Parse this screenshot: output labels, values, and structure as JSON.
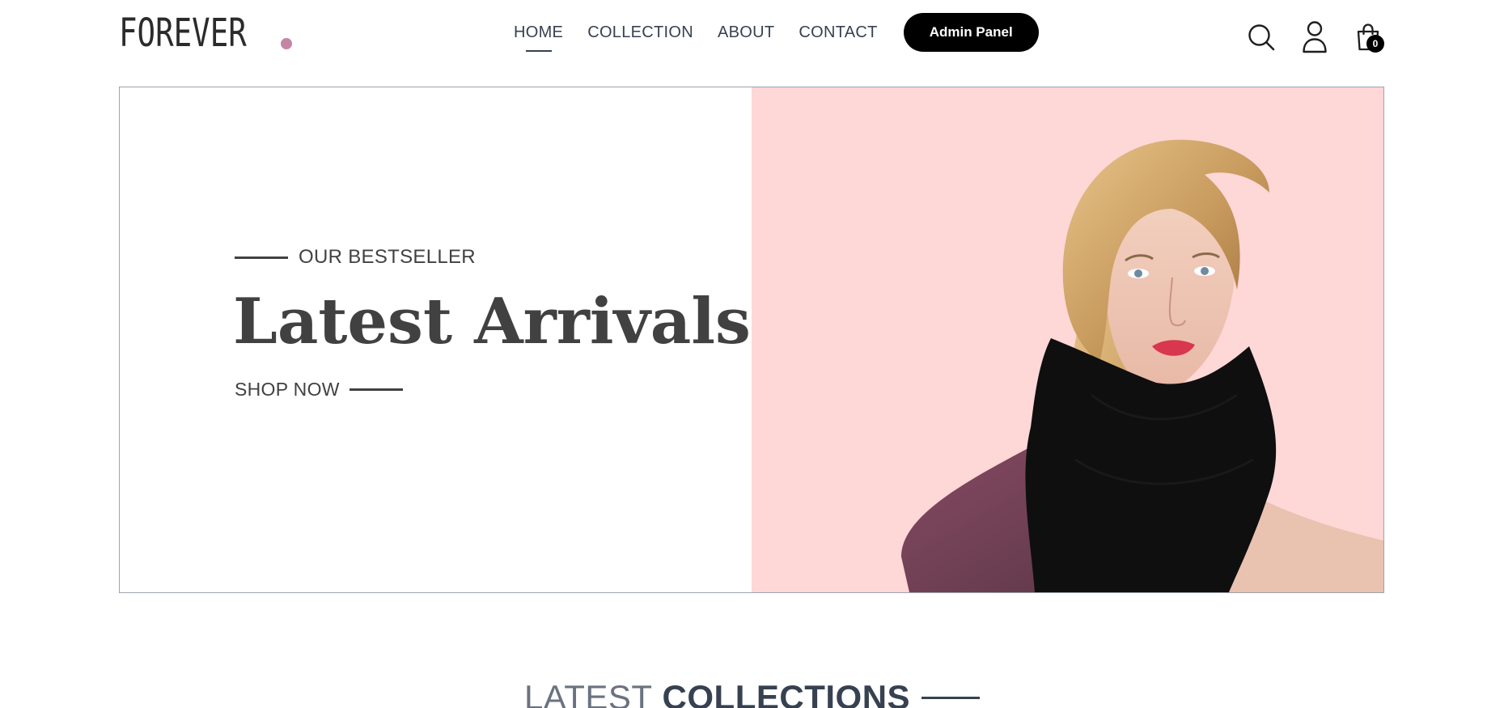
{
  "brand": {
    "logo_text": "FOREVER",
    "dot_color": "#c586a5"
  },
  "nav": {
    "links": [
      {
        "label": "HOME",
        "active": true
      },
      {
        "label": "COLLECTION",
        "active": false
      },
      {
        "label": "ABOUT",
        "active": false
      },
      {
        "label": "CONTACT",
        "active": false
      }
    ],
    "admin_button": "Admin Panel",
    "icons": [
      "search-icon",
      "user-icon",
      "bag-icon"
    ],
    "cart_count": "0"
  },
  "hero": {
    "eyebrow": "OUR BESTSELLER",
    "title": "Latest Arrivals",
    "cta": "SHOP NOW",
    "image_bg": "#fed7d7"
  },
  "section": {
    "title_light": "LATEST",
    "title_bold": "COLLECTIONS"
  }
}
